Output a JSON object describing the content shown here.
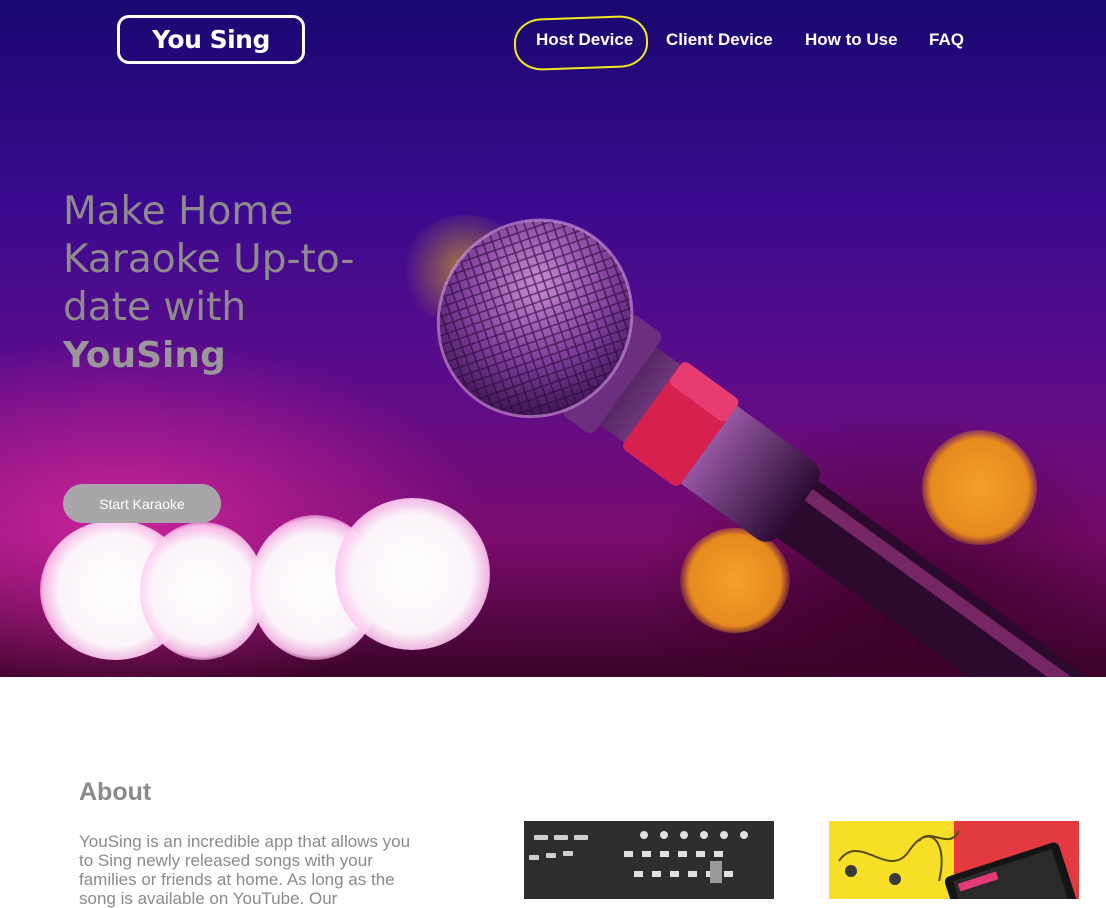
{
  "header": {
    "logo_text": "You Sing",
    "nav": [
      {
        "label": "Host Device",
        "highlighted": true
      },
      {
        "label": "Client Device"
      },
      {
        "label": "How to Use"
      },
      {
        "label": "FAQ"
      }
    ],
    "highlight_color": "#f2ea1f"
  },
  "hero": {
    "headline": "Make Home Karaoke Up-to-date with",
    "brand": "YouSing",
    "cta_label": "Start Karaoke"
  },
  "about": {
    "title": "About",
    "body": "YouSing is an incredible app that allows you to Sing newly released songs with your families or friends at home. As long as the song is available on YouTube. Our"
  },
  "colors": {
    "hero_top": "#1a0870",
    "hero_mid": "#5b0c8a",
    "text_gray": "#8a8a8a",
    "button_gray": "#a9a6a9"
  }
}
